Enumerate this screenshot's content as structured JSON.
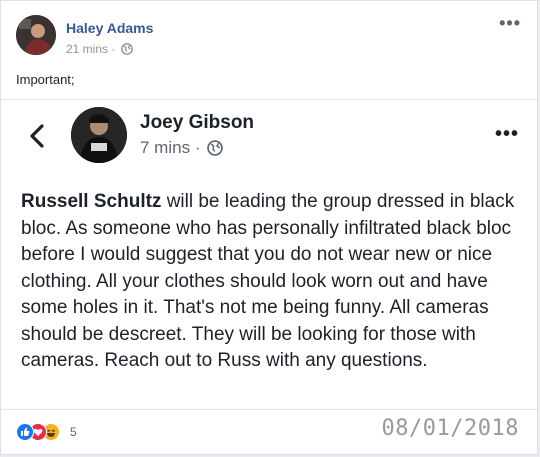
{
  "post": {
    "author": "Haley Adams",
    "time": "21 mins",
    "separator": "·",
    "text": "Important;"
  },
  "shared": {
    "author": "Joey Gibson",
    "time": "7 mins",
    "separator": "·",
    "body_bold": "Russell Schultz",
    "body_rest": " will be leading the group dressed in black bloc. As someone who has personally  infiltrated black bloc before I would suggest that you do not wear new or nice clothing.  All your clothes should look worn out and have some holes in it. That's not me being funny.  All cameras should be descreet. They will be looking for those with cameras. Reach out to Russ with any questions."
  },
  "footer": {
    "reaction_count": "5",
    "date_stamp": "08/01/2018"
  },
  "icons": {
    "menu": "more-dots-icon",
    "privacy": "globe-icon",
    "back": "chevron-left-icon",
    "reactions": [
      "like-icon",
      "love-icon",
      "haha-icon"
    ]
  },
  "colors": {
    "link": "#365899",
    "like": "#1877f2",
    "love": "#f0284a",
    "haha": "#f7b125"
  }
}
